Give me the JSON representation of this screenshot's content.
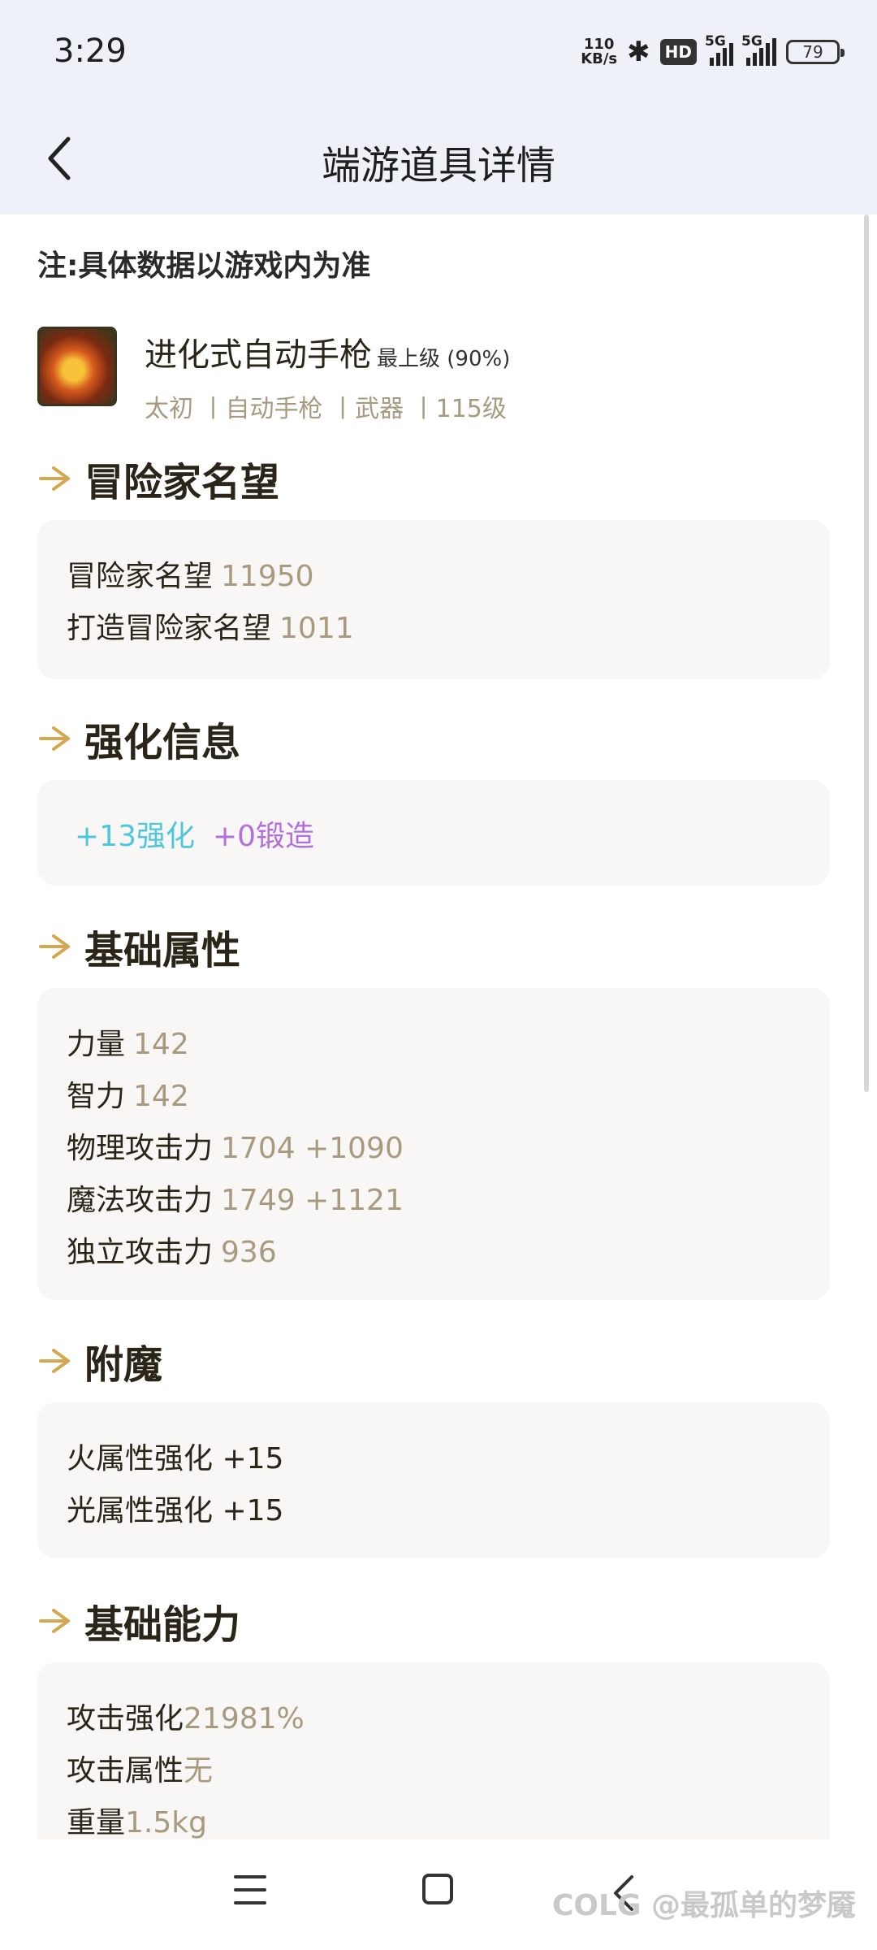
{
  "status_bar": {
    "time": "3:29",
    "net_speed_value": "110",
    "net_speed_unit": "KB/s",
    "hd_label": "HD",
    "sim1_label": "5G",
    "sim2_label": "5G",
    "battery": "79"
  },
  "header": {
    "title": "端游道具详情"
  },
  "notice": "注:具体数据以游戏内为准",
  "item": {
    "name": "进化式自动手枪",
    "grade": "最上级 (90%)",
    "meta": "太初 丨自动手枪 丨武器 丨115级"
  },
  "sections": {
    "fame": {
      "title": "冒险家名望",
      "rows": [
        {
          "label": "冒险家名望",
          "value": "11950"
        },
        {
          "label": "打造冒险家名望",
          "value": "1011"
        }
      ]
    },
    "enhance": {
      "title": "强化信息",
      "reinforce": "+13强化",
      "forge": "+0锻造"
    },
    "base_stats": {
      "title": "基础属性",
      "rows": [
        {
          "label": "力量",
          "value": "142"
        },
        {
          "label": "智力",
          "value": "142"
        },
        {
          "label": "物理攻击力",
          "value": "1704 +1090"
        },
        {
          "label": "魔法攻击力",
          "value": "1749 +1121"
        },
        {
          "label": "独立攻击力",
          "value": "936"
        }
      ]
    },
    "enchant": {
      "title": "附魔",
      "rows": [
        {
          "text": "火属性强化 +15"
        },
        {
          "text": "光属性强化 +15"
        }
      ]
    },
    "ability": {
      "title": "基础能力",
      "rows": [
        {
          "label": "攻击强化",
          "value": "21981%"
        },
        {
          "label": "攻击属性",
          "value": "无"
        },
        {
          "label": "重量",
          "value": "1.5kg"
        }
      ]
    }
  },
  "watermark": "COLG @最孤单的梦魇",
  "colors": {
    "accent": "#d4a850",
    "value": "#a79a7e",
    "cyan": "#4cc7de",
    "purple": "#b36ee0"
  }
}
